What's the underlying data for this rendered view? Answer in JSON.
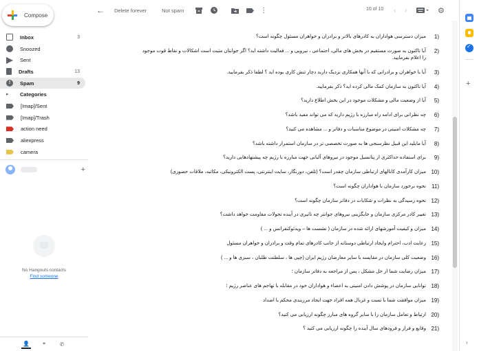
{
  "compose": {
    "label": "Compose"
  },
  "nav": {
    "items": [
      {
        "label": "Inbox",
        "count": "3"
      },
      {
        "label": "Snoozed",
        "count": ""
      },
      {
        "label": "Sent",
        "count": ""
      },
      {
        "label": "Drafts",
        "count": "13"
      },
      {
        "label": "Spam",
        "count": "9"
      },
      {
        "label": "Categories",
        "count": ""
      },
      {
        "label": "[Imap]/Sent",
        "count": ""
      },
      {
        "label": "[Imap]/Trash",
        "count": ""
      },
      {
        "label": "action need",
        "count": ""
      },
      {
        "label": "aliexpress",
        "count": ""
      },
      {
        "label": "camera",
        "count": ""
      }
    ],
    "label_colors": {
      "action_need": "#d93025",
      "camera": "#e8c54a"
    }
  },
  "hangouts": {
    "empty_text": "No Hangouts contacts",
    "find_link": "Find someone"
  },
  "toolbar": {
    "back_icon": "arrow-left-icon",
    "delete_forever": "Delete forever",
    "not_spam": "Not spam",
    "pager": "10 of 10"
  },
  "questions": [
    {
      "num": "1)",
      "text": "میزان دسترسی هواداران به کادرهای بالاتر و برادران و خواهران مسئول چگونه است؟"
    },
    {
      "num": "2)",
      "text": "آیا تاکنون به صورت مستقیم در بخش های مالی، اجتماعی ، نیرویی و ... فعالیت داشته اید؟ اگر جوابتان مثبت است اشکالات و نقاط قوت موجود را اعلام بفرمایید."
    },
    {
      "num": "3)",
      "text": "آیا با خواهران و برادرانی که با آنها همکاری نزدیک دارید دچار تنش کاری بوده اید ؟ لطفا ذکر بفرمایید."
    },
    {
      "num": "4)",
      "text": "آیا تاکنون به سازمان کمک مالی کرده اید؟ ذکر بفرمایید."
    },
    {
      "num": "5)",
      "text": "آیا از وضعیت مالی و مشکلات موجود در این بخش اطلاع دارید؟"
    },
    {
      "num": "6)",
      "text": "چه نظراتی برای ادامه راه مبارزه با رژیم دارید که می تواند مفید باشد؟"
    },
    {
      "num": "7)",
      "text": "چه مشکلات امنیتی در موضوع مناسبات و دفاتر و ... مشاهده می کنید؟"
    },
    {
      "num": "8)",
      "text": "آیا مایلید این قبیل نظرسنجی ها به صورت تخصصی تر در سازمان استمرار داشته باشد؟"
    },
    {
      "num": "9)",
      "text": "برای استفاده حداکثری از پتانسیل موجود در نیروهای آلبانی جهت مبارزه با رژیم چه پیشنهادهایی دارید؟"
    },
    {
      "num": "10)",
      "text": "میزان کارآمدی کانالهای ارتباطی سازمان چقدر است؟ (تلفن، دورنگار، سایت اینترنتی، پست الکترونیکی، مکاتبه، ملاقات حضوری)"
    },
    {
      "num": "11)",
      "text": "نحوه برخورد سازمان با هواداران چگونه است؟"
    },
    {
      "num": "12)",
      "text": "نحوه رسیدگی به نظرات و شکایات در دفاتر سازمان چگونه است؟"
    },
    {
      "num": "13)",
      "text": "تغییر کادر مرکزی سازمان و جایگزینی نیروهای جوانتر چه تاثیری در آینده تحولات مقاومت خواهد داشت؟"
    },
    {
      "num": "14)",
      "text": "میزان و کیفیت آموزشهای ارائه شده در سازمان ( نشست ها – ویدئوکنفرانس و ... )"
    },
    {
      "num": "15)",
      "text": "رعایت ادب، احترام وایجاد ارتباطی دوستانه از جانب کادرهای تمام وقت و برادران و خواهران مسئول"
    },
    {
      "num": "16)",
      "text": "وضعیت کلی سازمان در مقایسه با سایر معارضان رژیم ایران (چپی ها ، سلطنت طلبان ، سبزی ها و ... )"
    },
    {
      "num": "17)",
      "text": "میزان رضایت شما از حل مشکل ، پس از مراجعه به دفاتر سازمان ؛"
    },
    {
      "num": "18)",
      "text": "توانایی سازمان در پوشش دادن امنیتی به اعضاء و هواداران خود در مقابله با تهاجم های عناصر رژیم ؛"
    },
    {
      "num": "19)",
      "text": "میزان موافقت شما با تست و غربال همه افراد جهت ایجاد مرزبندی محکم با اضداد"
    },
    {
      "num": "20)",
      "text": "ارتباط و تعامل سازمان را با سایر گروه های مبارز چگونه ارزیابی می کنید؟"
    },
    {
      "num": "21)",
      "text": "وقایع و فراز و فرودهای سال آینده را چگونه ارزیابی می کنید ؟"
    }
  ],
  "colors": {
    "accent": "#1a73e8",
    "active_nav": "#e8e8e8"
  }
}
